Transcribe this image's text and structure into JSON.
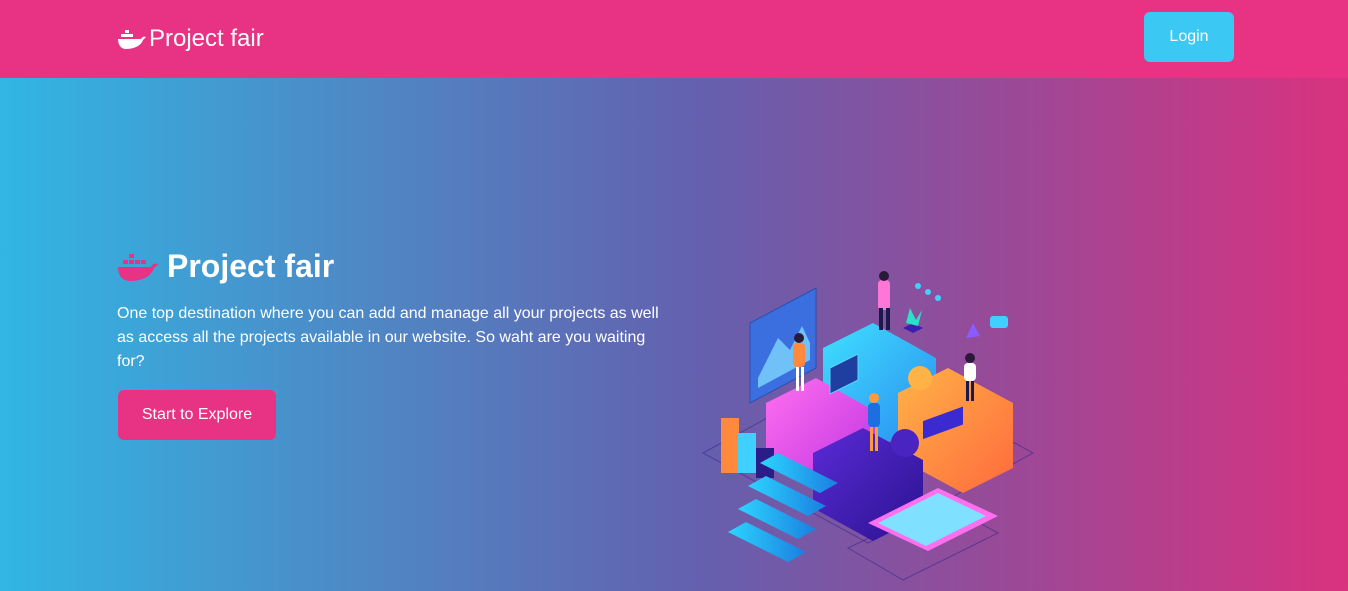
{
  "navbar": {
    "brand_icon": "docker-whale-icon",
    "brand_text": "Project fair",
    "login_label": "Login",
    "bg_color": "#e83283",
    "login_color": "#3bc8f3"
  },
  "hero": {
    "title_icon": "docker-whale-icon",
    "title": "Project fair",
    "description": "One top destination where you can add and manage all your projects as well as access all the projects available in our website. So waht are you waiting for?",
    "cta_label": "Start to Explore",
    "illustration": "isometric-teamwork-puzzle-illustration",
    "gradient_start": "#31b6e3",
    "gradient_end": "#d9327f"
  }
}
